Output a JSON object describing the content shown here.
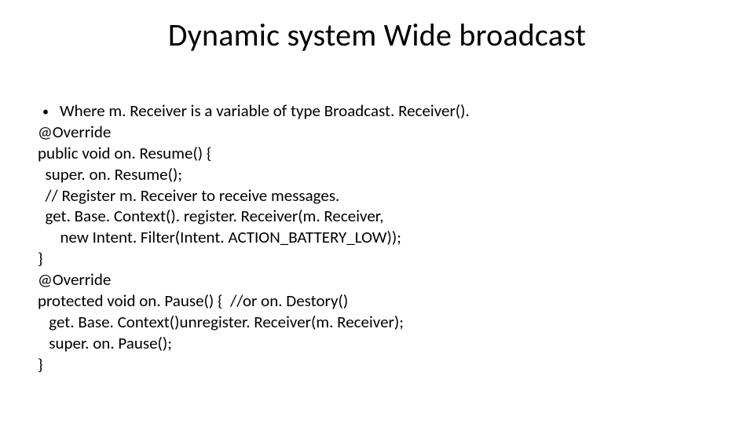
{
  "slide": {
    "title": "Dynamic system Wide broadcast",
    "bullet": "Where m. Receiver is a variable of type Broadcast. Receiver().",
    "code": "@Override\npublic void on. Resume() {\n  super. on. Resume();\n  // Register m. Receiver to receive messages.\n  get. Base. Context(). register. Receiver(m. Receiver,\n      new Intent. Filter(Intent. ACTION_BATTERY_LOW));\n}\n@Override\nprotected void on. Pause() {  //or on. Destory()\n   get. Base. Context()unregister. Receiver(m. Receiver);\n   super. on. Pause();\n}"
  }
}
